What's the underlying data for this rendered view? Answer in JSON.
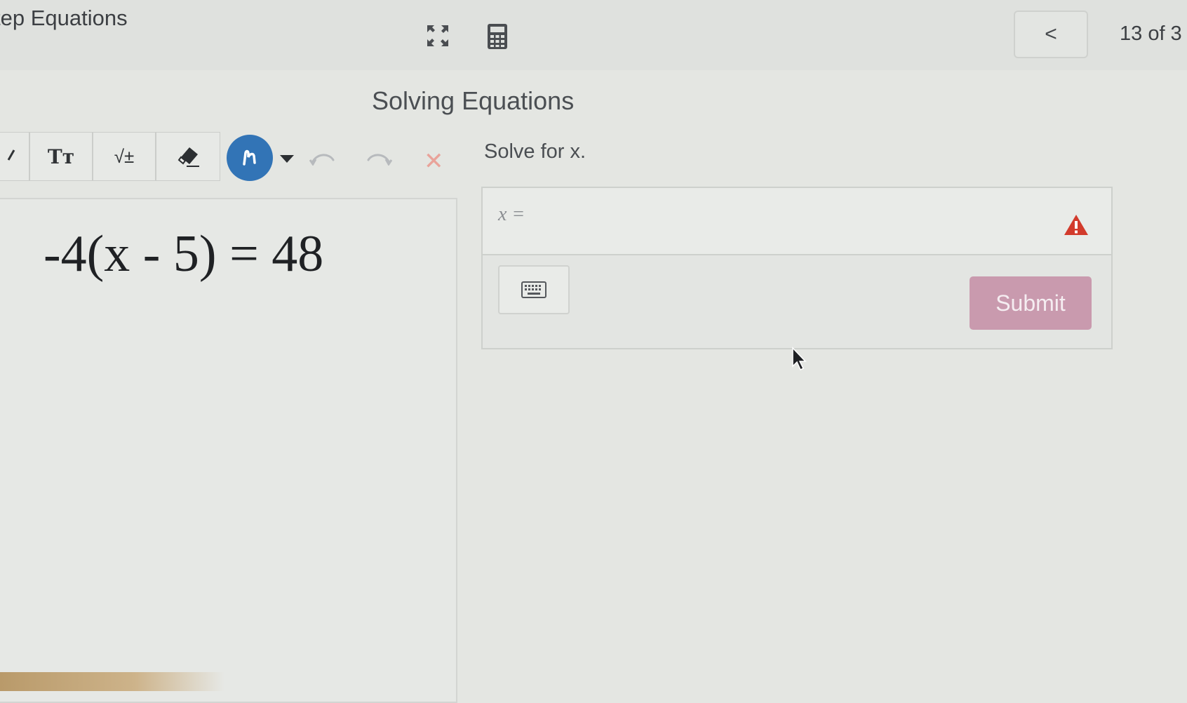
{
  "header": {
    "title": "tep Equations",
    "back_label": "<",
    "page_count": "13 of 3"
  },
  "main": {
    "heading": "Solving Equations",
    "equation": "-4(x - 5) = 48"
  },
  "toolbar": {
    "text_label": "Tт",
    "math_label": "√±",
    "draw_label": "ɿ̶",
    "clear_label": "✕"
  },
  "question": {
    "prompt": "Solve for x.",
    "answer_label": "x =",
    "answer_value": "",
    "submit_label": "Submit"
  },
  "colors": {
    "accent_blue": "#3274b6",
    "submit_pink": "#c99aae",
    "warning_red": "#d23b2c",
    "clear_red": "#e9a39a"
  },
  "icons": [
    "expand-icon",
    "calculator-icon",
    "pen-icon",
    "eraser-icon",
    "draw-icon",
    "dropdown-icon",
    "undo-icon",
    "redo-icon",
    "clear-icon",
    "warning-icon",
    "keyboard-icon",
    "mouse-cursor"
  ]
}
